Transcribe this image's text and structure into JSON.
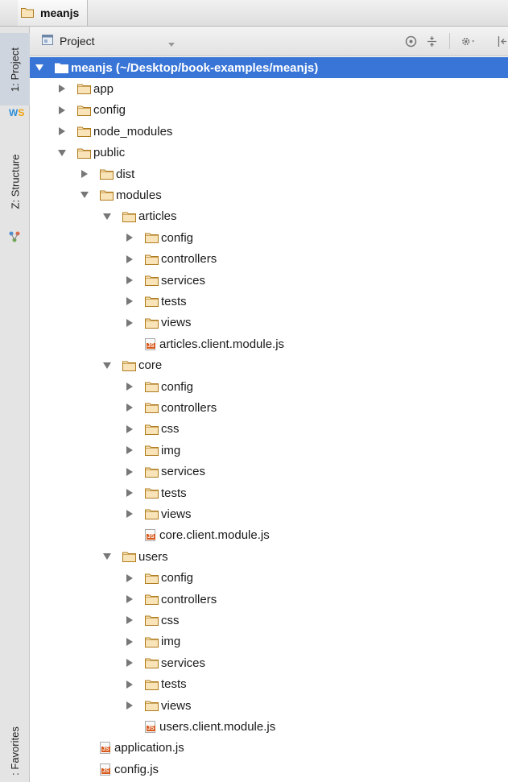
{
  "breadcrumb": {
    "project": "meanjs"
  },
  "sidebar": {
    "tabs": [
      {
        "label": "1: Project"
      },
      {
        "label": "Z: Structure"
      },
      {
        "label": ": Favorites"
      }
    ]
  },
  "toolbar": {
    "view_label": "Project",
    "icons": [
      "scroll-from-source-icon",
      "collapse-all-icon",
      "gear-icon",
      "hide-icon"
    ]
  },
  "tree": [
    {
      "depth": 0,
      "type": "folder",
      "expanded": true,
      "label": "meanjs (~/Desktop/book-examples/meanjs)",
      "selected": true
    },
    {
      "depth": 1,
      "type": "folder",
      "expanded": false,
      "label": "app"
    },
    {
      "depth": 1,
      "type": "folder",
      "expanded": false,
      "label": "config"
    },
    {
      "depth": 1,
      "type": "folder",
      "expanded": false,
      "label": "node_modules"
    },
    {
      "depth": 1,
      "type": "folder",
      "expanded": true,
      "label": "public"
    },
    {
      "depth": 2,
      "type": "folder",
      "expanded": false,
      "label": "dist"
    },
    {
      "depth": 2,
      "type": "folder",
      "expanded": true,
      "label": "modules"
    },
    {
      "depth": 3,
      "type": "folder",
      "expanded": true,
      "label": "articles"
    },
    {
      "depth": 4,
      "type": "folder",
      "expanded": false,
      "label": "config"
    },
    {
      "depth": 4,
      "type": "folder",
      "expanded": false,
      "label": "controllers"
    },
    {
      "depth": 4,
      "type": "folder",
      "expanded": false,
      "label": "services"
    },
    {
      "depth": 4,
      "type": "folder",
      "expanded": false,
      "label": "tests"
    },
    {
      "depth": 4,
      "type": "folder",
      "expanded": false,
      "label": "views"
    },
    {
      "depth": 4,
      "type": "file",
      "label": "articles.client.module.js"
    },
    {
      "depth": 3,
      "type": "folder",
      "expanded": true,
      "label": "core"
    },
    {
      "depth": 4,
      "type": "folder",
      "expanded": false,
      "label": "config"
    },
    {
      "depth": 4,
      "type": "folder",
      "expanded": false,
      "label": "controllers"
    },
    {
      "depth": 4,
      "type": "folder",
      "expanded": false,
      "label": "css"
    },
    {
      "depth": 4,
      "type": "folder",
      "expanded": false,
      "label": "img"
    },
    {
      "depth": 4,
      "type": "folder",
      "expanded": false,
      "label": "services"
    },
    {
      "depth": 4,
      "type": "folder",
      "expanded": false,
      "label": "tests"
    },
    {
      "depth": 4,
      "type": "folder",
      "expanded": false,
      "label": "views"
    },
    {
      "depth": 4,
      "type": "file",
      "label": "core.client.module.js"
    },
    {
      "depth": 3,
      "type": "folder",
      "expanded": true,
      "label": "users"
    },
    {
      "depth": 4,
      "type": "folder",
      "expanded": false,
      "label": "config"
    },
    {
      "depth": 4,
      "type": "folder",
      "expanded": false,
      "label": "controllers"
    },
    {
      "depth": 4,
      "type": "folder",
      "expanded": false,
      "label": "css"
    },
    {
      "depth": 4,
      "type": "folder",
      "expanded": false,
      "label": "img"
    },
    {
      "depth": 4,
      "type": "folder",
      "expanded": false,
      "label": "services"
    },
    {
      "depth": 4,
      "type": "folder",
      "expanded": false,
      "label": "tests"
    },
    {
      "depth": 4,
      "type": "folder",
      "expanded": false,
      "label": "views"
    },
    {
      "depth": 4,
      "type": "file",
      "label": "users.client.module.js"
    },
    {
      "depth": 2,
      "type": "file",
      "label": "application.js"
    },
    {
      "depth": 2,
      "type": "file",
      "label": "config.js"
    }
  ],
  "colors": {
    "selection": "#3875d7",
    "folder_fill": "#f8e4b8",
    "folder_stroke": "#b07b1e",
    "js_badge": "#d85a1c"
  }
}
